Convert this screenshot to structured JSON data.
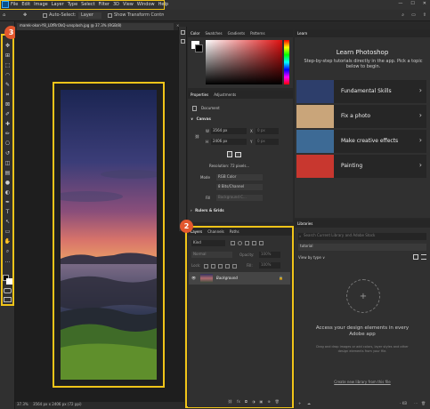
{
  "menu": [
    "File",
    "Edit",
    "Image",
    "Layer",
    "Type",
    "Select",
    "Filter",
    "3D",
    "View",
    "Window",
    "Help"
  ],
  "window_controls": {
    "minimize": "—",
    "maximize": "☐",
    "close": "✕"
  },
  "options_bar": {
    "auto_select": "Auto-Select:",
    "auto_select_target": "Layer",
    "transform_controls": "Show Transform Contro",
    "search_icon": "⌕",
    "workspace_icon": "▭",
    "share_icon": "⇪"
  },
  "callouts": {
    "tools": "3",
    "layers": "2"
  },
  "document": {
    "tab_title": "marek-okon-Y8_LOfRrOkQ-unsplash.jpg @ 37.3% (RGB/8)",
    "close_icon": "×"
  },
  "status_bar": {
    "zoom": "37.3%",
    "doc_info": "3564 px x 2406 px (72 ppi)"
  },
  "tools": [
    "move-tool-icon",
    "artboard-tool-icon",
    "marquee-tool-icon",
    "lasso-tool-icon",
    "quick-selection-icon",
    "crop-tool-icon",
    "frame-tool-icon",
    "eyedropper-icon",
    "spot-healing-icon",
    "brush-tool-icon",
    "clone-stamp-icon",
    "history-brush-icon",
    "eraser-icon",
    "gradient-tool-icon",
    "blur-tool-icon",
    "dodge-tool-icon",
    "pen-tool-icon",
    "type-tool-icon",
    "path-selection-icon",
    "rectangle-tool-icon",
    "hand-tool-icon",
    "zoom-tool-icon",
    "more-tools-icon"
  ],
  "tool_glyphs": [
    "✥",
    "⊞",
    "⬚",
    "◠",
    "✎",
    "⌗",
    "⊠",
    "✐",
    "✚",
    "✏",
    "⎔",
    "↺",
    "◫",
    "▤",
    "●",
    "◐",
    "✒",
    "T",
    "↖",
    "▭",
    "✋",
    "⌕",
    "…"
  ],
  "color_panel": {
    "tabs": [
      "Color",
      "Swatches",
      "Gradients",
      "Patterns"
    ]
  },
  "properties_panel": {
    "tabs": [
      "Properties",
      "Adjustments"
    ],
    "subject": "Document",
    "section_chevron": "∨",
    "section_chevron_collapsed": "›",
    "canvas_section": "Canvas",
    "width_label": "W",
    "width_value": "3564 px",
    "x_label": "X",
    "x_value": "0 px",
    "link_icon": "⛓",
    "height_label": "H",
    "height_value": "2406 px",
    "y_label": "Y",
    "y_value": "0 px",
    "resolution": "Resolution: 72 pixels...",
    "mode_label": "Mode",
    "mode_value": "RGB Color",
    "bit_depth": "8 Bits/Channel",
    "fill_label": "Fill",
    "fill_value": "Background C...",
    "rulers_section": "Rulers & Grids"
  },
  "layers_panel": {
    "tabs": [
      "Layers",
      "Channels",
      "Paths"
    ],
    "filter_kind": "Kind",
    "blend_mode": "Normal",
    "opacity_label": "Opacity:",
    "opacity_value": "100%",
    "lock_label": "Lock:",
    "fill_label": "Fill:",
    "fill_value": "100%",
    "eye_icon": "👁",
    "layer_name": "Background",
    "layer_lock_icon": "🔒",
    "footer_icons": [
      "⛓",
      "fx",
      "◘",
      "◑",
      "▣",
      "⊕",
      "🗑"
    ]
  },
  "learn_panel": {
    "tab": "Learn",
    "heading": "Learn Photoshop",
    "intro": "Step-by-step tutorials directly in the app. Pick a topic below to begin.",
    "chevron": "›",
    "topics": [
      {
        "label": "Fundamental Skills",
        "thumb_color": "#2d3e6b",
        "icon": "fundamental-skills-thumbnail"
      },
      {
        "label": "Fix a photo",
        "thumb_color": "#c9a57a",
        "icon": "fix-photo-thumbnail"
      },
      {
        "label": "Make creative effects",
        "thumb_color": "#3d6a95",
        "icon": "creative-effects-thumbnail"
      },
      {
        "label": "Painting",
        "thumb_color": "#c8372f",
        "icon": "painting-thumbnail"
      }
    ]
  },
  "libraries_panel": {
    "tab": "Libraries",
    "search_placeholder": "Search Current Library and Adobe Stock",
    "library_name": "tutorial",
    "view_by": "View by type ∨",
    "plus_icon": "+",
    "empty_heading": "Access your design elements in every Adobe app",
    "empty_help": "Drag and drop images or add colors, layer styles and other design elements from your file.",
    "create_link": "Create new library from this file",
    "footer": {
      "add": "+",
      "cloud": "☁",
      "size": "- KB",
      "more": "⋯",
      "delete": "🗑"
    }
  }
}
